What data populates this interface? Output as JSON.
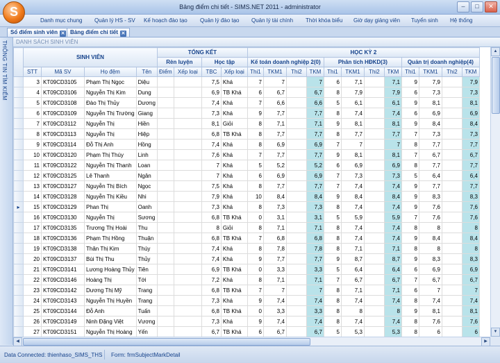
{
  "window": {
    "title": "Bảng điểm chi tiết - SIMS.NET 2011 - administrator",
    "logo_letter": "S"
  },
  "menu": [
    "Danh mục chung",
    "Quản lý HS - SV",
    "Kế hoạch đào tạo",
    "Quản lý đào tạo",
    "Quản lý tài chính",
    "Thời khóa biểu",
    "Giờ dạy giảng viên",
    "Tuyển sinh",
    "Hệ thống"
  ],
  "tabs": [
    "Sổ điểm sinh viên",
    "Bảng điểm chi tiết"
  ],
  "sidebar_label": "THÔNG TIN TÌM KIẾM",
  "panel_title": "DANH SÁCH SINH VIÊN",
  "headers": {
    "sinh_vien": "SINH VIÊN",
    "tong_ket": "TỔNG KẾT",
    "ren_luyen": "Rèn luyện",
    "hoc_tap": "Học tập",
    "hoc_ky": "HỌC KỲ 2",
    "subjects": [
      "Kế toán doanh nghiệp 2(0)",
      "Phân tích HĐKD(3)",
      "Quản trị doanh nghiệp(4)"
    ],
    "cols": [
      "STT",
      "Mã SV",
      "Họ đệm",
      "Tên",
      "Điểm",
      "Xếp loại",
      "TBC",
      "Xếp loại"
    ],
    "subject_cols": [
      "Thi1",
      "TKM1",
      "Thi2",
      "TKM"
    ]
  },
  "rows": [
    {
      "stt": "3",
      "ma": "KT09CD3105",
      "ho": "Phạm Thị Ngọc",
      "ten": "Diệu",
      "tbc": "7,5",
      "xl": "Khá",
      "s1": [
        "7",
        "7",
        "",
        "7"
      ],
      "s2": [
        "6",
        "7,1",
        "",
        "7,1"
      ],
      "s3": [
        "9",
        "7,9",
        "",
        "7,9"
      ]
    },
    {
      "stt": "4",
      "ma": "KT09CD3106",
      "ho": "Nguyễn Thị Kim",
      "ten": "Dung",
      "tbc": "6,9",
      "xl": "TB Khá",
      "s1": [
        "6",
        "6,7",
        "",
        "6,7"
      ],
      "s2": [
        "8",
        "7,9",
        "",
        "7,9"
      ],
      "s3": [
        "6",
        "7,3",
        "",
        "7,3"
      ]
    },
    {
      "stt": "5",
      "ma": "KT09CD3108",
      "ho": "Đào Thị Thủy",
      "ten": "Dương",
      "tbc": "7,4",
      "xl": "Khá",
      "s1": [
        "7",
        "6,6",
        "",
        "6,6"
      ],
      "s2": [
        "5",
        "6,1",
        "",
        "6,1"
      ],
      "s3": [
        "9",
        "8,1",
        "",
        "8,1"
      ]
    },
    {
      "stt": "6",
      "ma": "KT09CD3109",
      "ho": "Nguyễn Thị Trường",
      "ten": "Giang",
      "tbc": "7,3",
      "xl": "Khá",
      "s1": [
        "9",
        "7,7",
        "",
        "7,7"
      ],
      "s2": [
        "8",
        "7,4",
        "",
        "7,4"
      ],
      "s3": [
        "6",
        "6,9",
        "",
        "6,9"
      ]
    },
    {
      "stt": "7",
      "ma": "KT09CD3112",
      "ho": "Nguyễn Thị",
      "ten": "Hiền",
      "tbc": "8,1",
      "xl": "Giỏi",
      "s1": [
        "8",
        "7,1",
        "",
        "7,1"
      ],
      "s2": [
        "9",
        "8,1",
        "",
        "8,1"
      ],
      "s3": [
        "9",
        "8,4",
        "",
        "8,4"
      ]
    },
    {
      "stt": "8",
      "ma": "KT09CD3113",
      "ho": "Nguyễn Thị",
      "ten": "Hiệp",
      "tbc": "6,8",
      "xl": "TB Khá",
      "s1": [
        "8",
        "7,7",
        "",
        "7,7"
      ],
      "s2": [
        "8",
        "7,7",
        "",
        "7,7"
      ],
      "s3": [
        "7",
        "7,3",
        "",
        "7,3"
      ]
    },
    {
      "stt": "9",
      "ma": "KT09CD3114",
      "ho": "Đỗ Thị Anh",
      "ten": "Hồng",
      "tbc": "7,4",
      "xl": "Khá",
      "s1": [
        "8",
        "6,9",
        "",
        "6,9"
      ],
      "s2": [
        "7",
        "7",
        "",
        "7"
      ],
      "s3": [
        "8",
        "7,7",
        "",
        "7,7"
      ]
    },
    {
      "stt": "10",
      "ma": "KT09CD3120",
      "ho": "Phạm Thị Thúy",
      "ten": "Linh",
      "tbc": "7,6",
      "xl": "Khá",
      "s1": [
        "7",
        "7,7",
        "",
        "7,7"
      ],
      "s2": [
        "9",
        "8,1",
        "",
        "8,1"
      ],
      "s3": [
        "7",
        "6,7",
        "",
        "6,7"
      ]
    },
    {
      "stt": "11",
      "ma": "KT09CD3122",
      "ho": "Nguyễn Thị Thanh",
      "ten": "Loan",
      "tbc": "7",
      "xl": "Khá",
      "s1": [
        "5",
        "5,2",
        "",
        "5,2"
      ],
      "s2": [
        "6",
        "6,9",
        "",
        "6,9"
      ],
      "s3": [
        "8",
        "7,7",
        "",
        "7,7"
      ]
    },
    {
      "stt": "12",
      "ma": "KT09CD3125",
      "ho": "Lê Thanh",
      "ten": "Ngân",
      "tbc": "7",
      "xl": "Khá",
      "s1": [
        "6",
        "6,9",
        "",
        "6,9"
      ],
      "s2": [
        "7",
        "7,3",
        "",
        "7,3"
      ],
      "s3": [
        "5",
        "6,4",
        "",
        "6,4"
      ]
    },
    {
      "stt": "13",
      "ma": "KT09CD3127",
      "ho": "Nguyễn Thị Bích",
      "ten": "Ngọc",
      "tbc": "7,5",
      "xl": "Khá",
      "s1": [
        "8",
        "7,7",
        "",
        "7,7"
      ],
      "s2": [
        "7",
        "7,4",
        "",
        "7,4"
      ],
      "s3": [
        "9",
        "7,7",
        "",
        "7,7"
      ]
    },
    {
      "stt": "14",
      "ma": "KT09CD3128",
      "ho": "Nguyễn Thị Kiều",
      "ten": "Nhi",
      "tbc": "7,9",
      "xl": "Khá",
      "s1": [
        "10",
        "8,4",
        "",
        "8,4"
      ],
      "s2": [
        "9",
        "8,4",
        "",
        "8,4"
      ],
      "s3": [
        "9",
        "8,3",
        "",
        "8,3"
      ]
    },
    {
      "stt": "15",
      "ma": "KT09CD3129",
      "ho": "Phan Thị",
      "ten": "Oanh",
      "tbc": "7,3",
      "xl": "Khá",
      "s1": [
        "8",
        "7,3",
        "",
        "7,3"
      ],
      "s2": [
        "8",
        "7,4",
        "",
        "7,4"
      ],
      "s3": [
        "9",
        "7,6",
        "",
        "7,6"
      ],
      "cur": true
    },
    {
      "stt": "16",
      "ma": "KT09CD3130",
      "ho": "Nguyễn Thị",
      "ten": "Sương",
      "tbc": "6,8",
      "xl": "TB Khá",
      "s1": [
        "0",
        "3,1",
        "",
        "3,1"
      ],
      "s2": [
        "5",
        "5,9",
        "",
        "5,9"
      ],
      "s3": [
        "7",
        "7,6",
        "",
        "7,6"
      ]
    },
    {
      "stt": "17",
      "ma": "KT09CD3135",
      "ho": "Trương Thị Hoài",
      "ten": "Thu",
      "tbc": "8",
      "xl": "Giỏi",
      "s1": [
        "8",
        "7,1",
        "",
        "7,1"
      ],
      "s2": [
        "8",
        "7,4",
        "",
        "7,4"
      ],
      "s3": [
        "8",
        "8",
        "",
        "8"
      ]
    },
    {
      "stt": "18",
      "ma": "KT09CD3136",
      "ho": "Phạm Thị Hồng",
      "ten": "Thuận",
      "tbc": "6,8",
      "xl": "TB Khá",
      "s1": [
        "7",
        "6,8",
        "",
        "6,8"
      ],
      "s2": [
        "8",
        "7,4",
        "",
        "7,4"
      ],
      "s3": [
        "9",
        "8,4",
        "",
        "8,4"
      ]
    },
    {
      "stt": "19",
      "ma": "KT09CD3138",
      "ho": "Thân Thị Kim",
      "ten": "Thúy",
      "tbc": "7,4",
      "xl": "Khá",
      "s1": [
        "8",
        "7,8",
        "",
        "7,8"
      ],
      "s2": [
        "8",
        "7,1",
        "",
        "7,1"
      ],
      "s3": [
        "8",
        "8",
        "",
        "8"
      ]
    },
    {
      "stt": "20",
      "ma": "KT09CD3137",
      "ho": "Bùi Thị Thu",
      "ten": "Thủy",
      "tbc": "7,4",
      "xl": "Khá",
      "s1": [
        "9",
        "7,7",
        "",
        "7,7"
      ],
      "s2": [
        "9",
        "8,7",
        "",
        "8,7"
      ],
      "s3": [
        "9",
        "8,3",
        "",
        "8,3"
      ]
    },
    {
      "stt": "21",
      "ma": "KT09CD3141",
      "ho": "Lương Hoàng Thủy",
      "ten": "Tiên",
      "tbc": "6,9",
      "xl": "TB Khá",
      "s1": [
        "0",
        "3,3",
        "",
        "3,3"
      ],
      "s2": [
        "5",
        "6,4",
        "",
        "6,4"
      ],
      "s3": [
        "6",
        "6,9",
        "",
        "6,9"
      ]
    },
    {
      "stt": "22",
      "ma": "KT09CD3146",
      "ho": "Hoàng Thị",
      "ten": "Tới",
      "tbc": "7,2",
      "xl": "Khá",
      "s1": [
        "8",
        "7,1",
        "",
        "7,1"
      ],
      "s2": [
        "7",
        "6,7",
        "",
        "6,7"
      ],
      "s3": [
        "7",
        "6,7",
        "",
        "6,7"
      ]
    },
    {
      "stt": "23",
      "ma": "KT09CD3142",
      "ho": "Dương Thị Mỹ",
      "ten": "Trang",
      "tbc": "6,8",
      "xl": "TB Khá",
      "s1": [
        "7",
        "7",
        "",
        "7"
      ],
      "s2": [
        "8",
        "7,1",
        "",
        "7,1"
      ],
      "s3": [
        "6",
        "7",
        "",
        "7"
      ]
    },
    {
      "stt": "24",
      "ma": "KT09CD3143",
      "ho": "Nguyễn Thị Huyền",
      "ten": "Trang",
      "tbc": "7,3",
      "xl": "Khá",
      "s1": [
        "9",
        "7,4",
        "",
        "7,4"
      ],
      "s2": [
        "8",
        "7,4",
        "",
        "7,4"
      ],
      "s3": [
        "8",
        "7,4",
        "",
        "7,4"
      ]
    },
    {
      "stt": "25",
      "ma": "KT09CD3144",
      "ho": "Đỗ Anh",
      "ten": "Tuấn",
      "tbc": "6,8",
      "xl": "TB Khá",
      "s1": [
        "0",
        "3,3",
        "",
        "3,3"
      ],
      "s2": [
        "8",
        "8",
        "",
        "8"
      ],
      "s3": [
        "9",
        "8,1",
        "",
        "8,1"
      ]
    },
    {
      "stt": "26",
      "ma": "KT09CD3149",
      "ho": "Ninh Đặng Việt",
      "ten": "Vương",
      "tbc": "7,3",
      "xl": "Khá",
      "s1": [
        "9",
        "7,4",
        "",
        "7,4"
      ],
      "s2": [
        "8",
        "7,4",
        "",
        "7,4"
      ],
      "s3": [
        "8",
        "7,6",
        "",
        "7,6"
      ]
    },
    {
      "stt": "27",
      "ma": "KT09CD3151",
      "ho": "Nguyễn Thị Hoàng",
      "ten": "Yến",
      "tbc": "6,7",
      "xl": "TB Khá",
      "s1": [
        "6",
        "6,7",
        "",
        "6,7"
      ],
      "s2": [
        "5",
        "5,3",
        "",
        "5,3"
      ],
      "s3": [
        "8",
        "6",
        "",
        "6"
      ]
    }
  ],
  "status": {
    "connection": "Data Connected: thienhaso_SIMS_THS",
    "form": "Form: frmSubjectMarkDetail"
  },
  "colors": {
    "highlight": "#b9e3ea",
    "accent": "#15428b"
  }
}
